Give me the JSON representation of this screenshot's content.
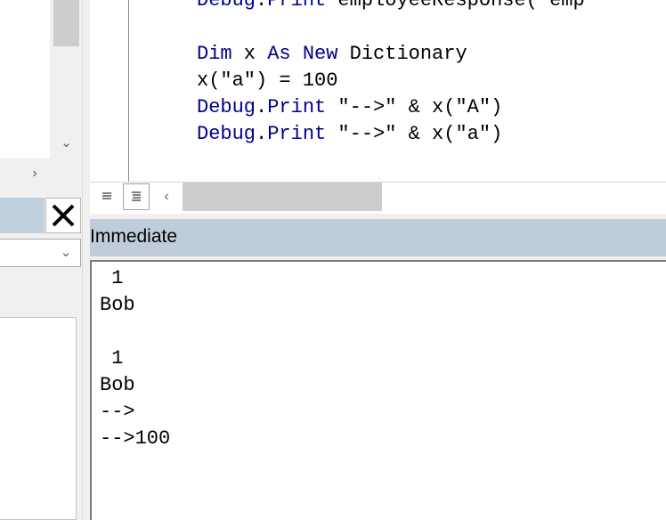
{
  "code_window": {
    "lines": [
      {
        "kw": "Debug",
        "text": ".",
        "kw2": "Print",
        "rest": " employeeResponse( emp"
      },
      {
        "kw": "Dim",
        "text": " x ",
        "kw2": "As New",
        "rest": " Dictionary"
      },
      {
        "plain": "x(\"a\") = 100"
      },
      {
        "kw": "Debug",
        "text": ".",
        "kw2": "Print",
        "rest": " \"-->\" & x(\"A\")"
      },
      {
        "kw": "Debug",
        "text": ".",
        "kw2": "Print",
        "rest": " \"-->\" & x(\"a\")"
      }
    ],
    "procedure_view_icon": "procedure-view-icon",
    "full_module_view_icon": "full-module-view-icon"
  },
  "immediate": {
    "title": "Immediate",
    "lines": [
      " 1",
      "Bob",
      "",
      " 1",
      "Bob",
      "-->",
      "-->100"
    ]
  },
  "left_panel": {
    "close_icon": "close-icon",
    "dropdown_value": ""
  },
  "colors": {
    "keyword": "#00008b",
    "titlebar": "#bfcddb"
  }
}
